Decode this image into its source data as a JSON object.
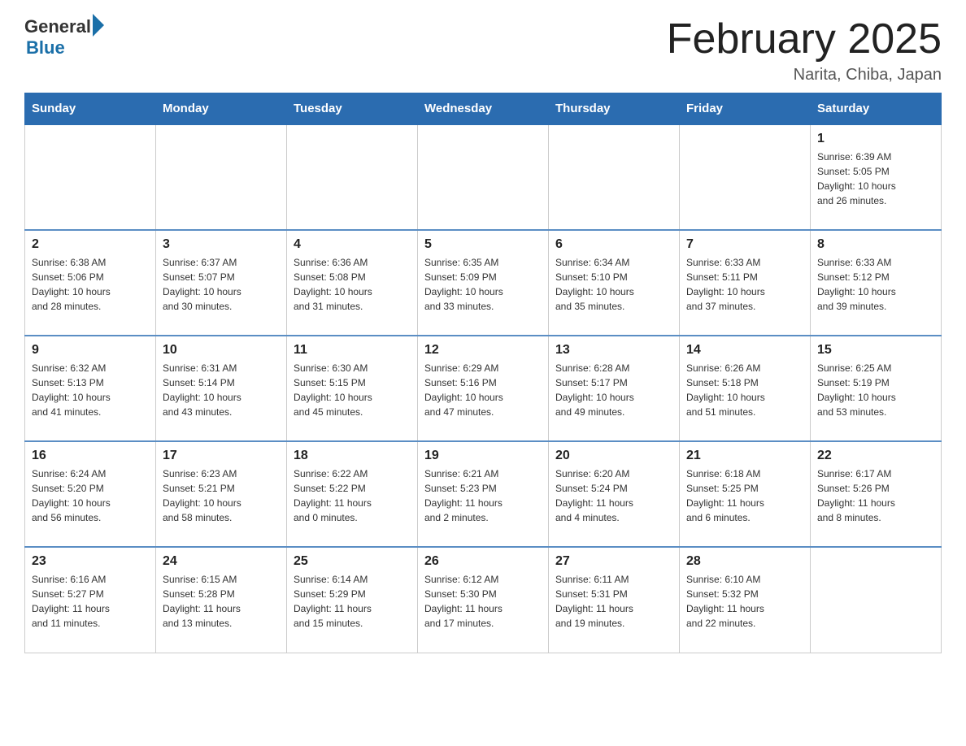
{
  "header": {
    "logo_general": "General",
    "logo_blue": "Blue",
    "month_title": "February 2025",
    "location": "Narita, Chiba, Japan"
  },
  "weekdays": [
    "Sunday",
    "Monday",
    "Tuesday",
    "Wednesday",
    "Thursday",
    "Friday",
    "Saturday"
  ],
  "weeks": [
    [
      {
        "day": "",
        "info": ""
      },
      {
        "day": "",
        "info": ""
      },
      {
        "day": "",
        "info": ""
      },
      {
        "day": "",
        "info": ""
      },
      {
        "day": "",
        "info": ""
      },
      {
        "day": "",
        "info": ""
      },
      {
        "day": "1",
        "info": "Sunrise: 6:39 AM\nSunset: 5:05 PM\nDaylight: 10 hours\nand 26 minutes."
      }
    ],
    [
      {
        "day": "2",
        "info": "Sunrise: 6:38 AM\nSunset: 5:06 PM\nDaylight: 10 hours\nand 28 minutes."
      },
      {
        "day": "3",
        "info": "Sunrise: 6:37 AM\nSunset: 5:07 PM\nDaylight: 10 hours\nand 30 minutes."
      },
      {
        "day": "4",
        "info": "Sunrise: 6:36 AM\nSunset: 5:08 PM\nDaylight: 10 hours\nand 31 minutes."
      },
      {
        "day": "5",
        "info": "Sunrise: 6:35 AM\nSunset: 5:09 PM\nDaylight: 10 hours\nand 33 minutes."
      },
      {
        "day": "6",
        "info": "Sunrise: 6:34 AM\nSunset: 5:10 PM\nDaylight: 10 hours\nand 35 minutes."
      },
      {
        "day": "7",
        "info": "Sunrise: 6:33 AM\nSunset: 5:11 PM\nDaylight: 10 hours\nand 37 minutes."
      },
      {
        "day": "8",
        "info": "Sunrise: 6:33 AM\nSunset: 5:12 PM\nDaylight: 10 hours\nand 39 minutes."
      }
    ],
    [
      {
        "day": "9",
        "info": "Sunrise: 6:32 AM\nSunset: 5:13 PM\nDaylight: 10 hours\nand 41 minutes."
      },
      {
        "day": "10",
        "info": "Sunrise: 6:31 AM\nSunset: 5:14 PM\nDaylight: 10 hours\nand 43 minutes."
      },
      {
        "day": "11",
        "info": "Sunrise: 6:30 AM\nSunset: 5:15 PM\nDaylight: 10 hours\nand 45 minutes."
      },
      {
        "day": "12",
        "info": "Sunrise: 6:29 AM\nSunset: 5:16 PM\nDaylight: 10 hours\nand 47 minutes."
      },
      {
        "day": "13",
        "info": "Sunrise: 6:28 AM\nSunset: 5:17 PM\nDaylight: 10 hours\nand 49 minutes."
      },
      {
        "day": "14",
        "info": "Sunrise: 6:26 AM\nSunset: 5:18 PM\nDaylight: 10 hours\nand 51 minutes."
      },
      {
        "day": "15",
        "info": "Sunrise: 6:25 AM\nSunset: 5:19 PM\nDaylight: 10 hours\nand 53 minutes."
      }
    ],
    [
      {
        "day": "16",
        "info": "Sunrise: 6:24 AM\nSunset: 5:20 PM\nDaylight: 10 hours\nand 56 minutes."
      },
      {
        "day": "17",
        "info": "Sunrise: 6:23 AM\nSunset: 5:21 PM\nDaylight: 10 hours\nand 58 minutes."
      },
      {
        "day": "18",
        "info": "Sunrise: 6:22 AM\nSunset: 5:22 PM\nDaylight: 11 hours\nand 0 minutes."
      },
      {
        "day": "19",
        "info": "Sunrise: 6:21 AM\nSunset: 5:23 PM\nDaylight: 11 hours\nand 2 minutes."
      },
      {
        "day": "20",
        "info": "Sunrise: 6:20 AM\nSunset: 5:24 PM\nDaylight: 11 hours\nand 4 minutes."
      },
      {
        "day": "21",
        "info": "Sunrise: 6:18 AM\nSunset: 5:25 PM\nDaylight: 11 hours\nand 6 minutes."
      },
      {
        "day": "22",
        "info": "Sunrise: 6:17 AM\nSunset: 5:26 PM\nDaylight: 11 hours\nand 8 minutes."
      }
    ],
    [
      {
        "day": "23",
        "info": "Sunrise: 6:16 AM\nSunset: 5:27 PM\nDaylight: 11 hours\nand 11 minutes."
      },
      {
        "day": "24",
        "info": "Sunrise: 6:15 AM\nSunset: 5:28 PM\nDaylight: 11 hours\nand 13 minutes."
      },
      {
        "day": "25",
        "info": "Sunrise: 6:14 AM\nSunset: 5:29 PM\nDaylight: 11 hours\nand 15 minutes."
      },
      {
        "day": "26",
        "info": "Sunrise: 6:12 AM\nSunset: 5:30 PM\nDaylight: 11 hours\nand 17 minutes."
      },
      {
        "day": "27",
        "info": "Sunrise: 6:11 AM\nSunset: 5:31 PM\nDaylight: 11 hours\nand 19 minutes."
      },
      {
        "day": "28",
        "info": "Sunrise: 6:10 AM\nSunset: 5:32 PM\nDaylight: 11 hours\nand 22 minutes."
      },
      {
        "day": "",
        "info": ""
      }
    ]
  ]
}
